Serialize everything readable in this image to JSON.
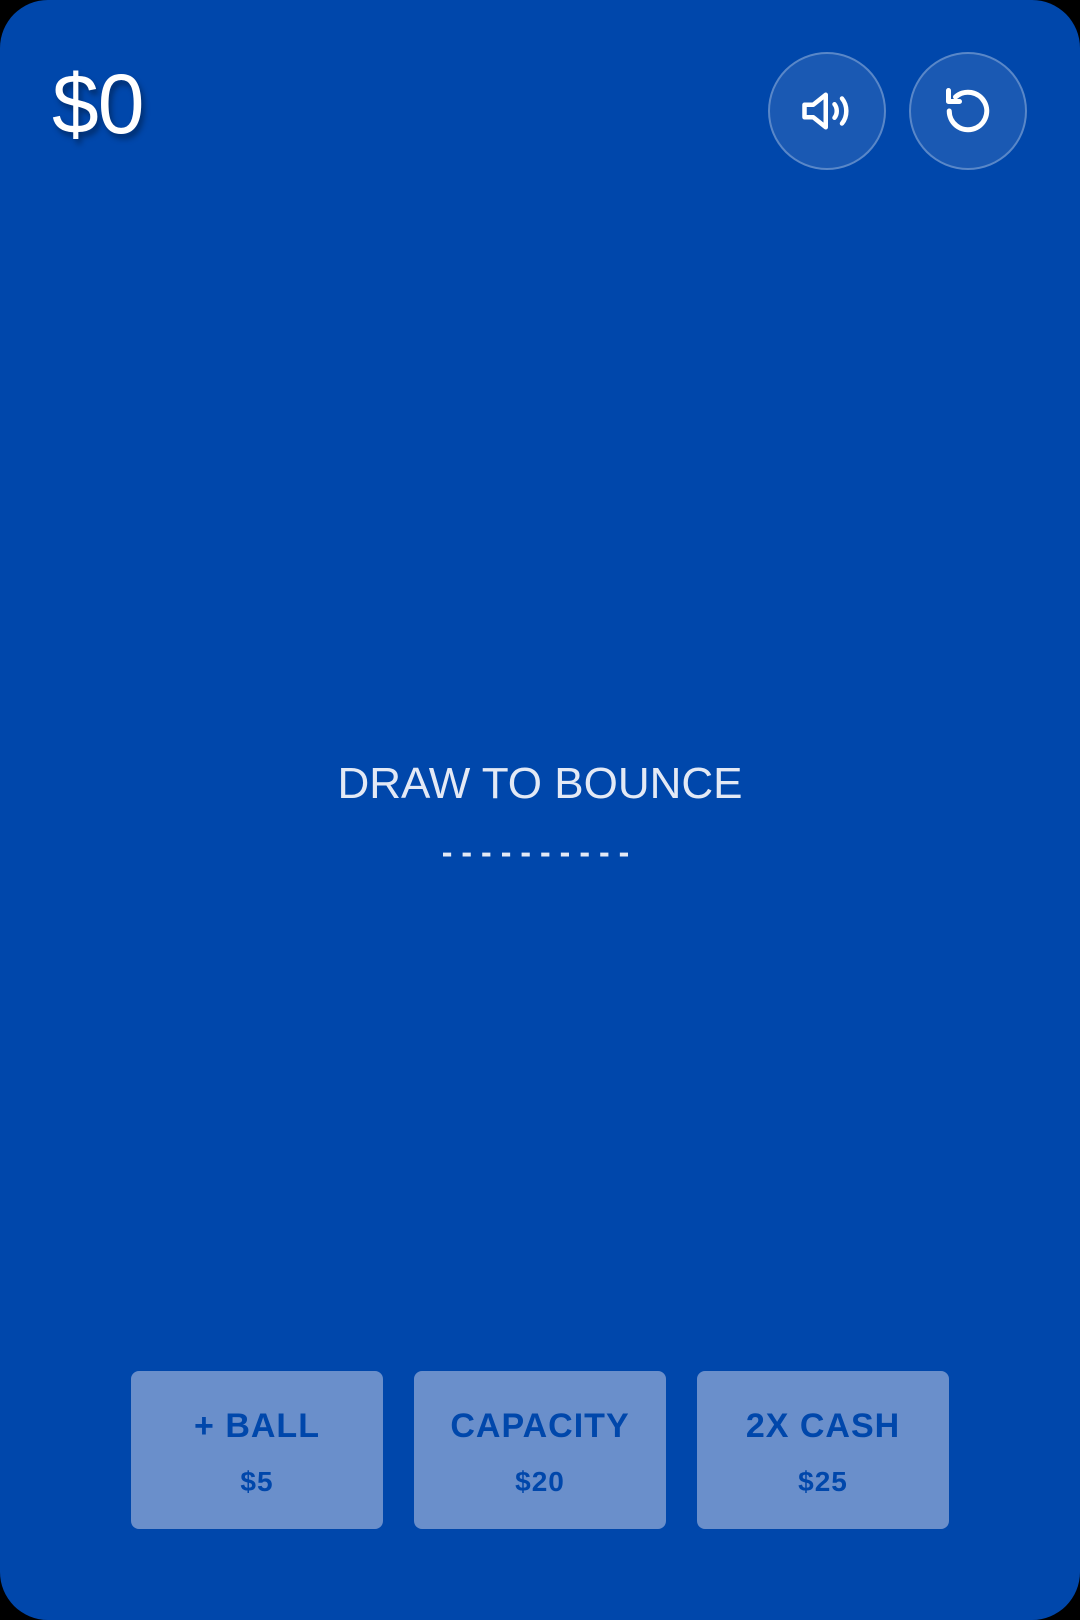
{
  "hud": {
    "cash": "$0",
    "sound_icon": "speaker-volume-icon",
    "restart_icon": "restart-icon"
  },
  "prompt": {
    "title": "DRAW TO BOUNCE",
    "dashes": "----------"
  },
  "shop": {
    "items": [
      {
        "label": "+ BALL",
        "price": "$5"
      },
      {
        "label": "CAPACITY",
        "price": "$20"
      },
      {
        "label": "2X CASH",
        "price": "$25"
      }
    ]
  },
  "colors": {
    "background": "#0047AB",
    "shop_button": "#6A8FCB",
    "shop_text": "#0047AB",
    "text_light": "#E3E9F5"
  }
}
